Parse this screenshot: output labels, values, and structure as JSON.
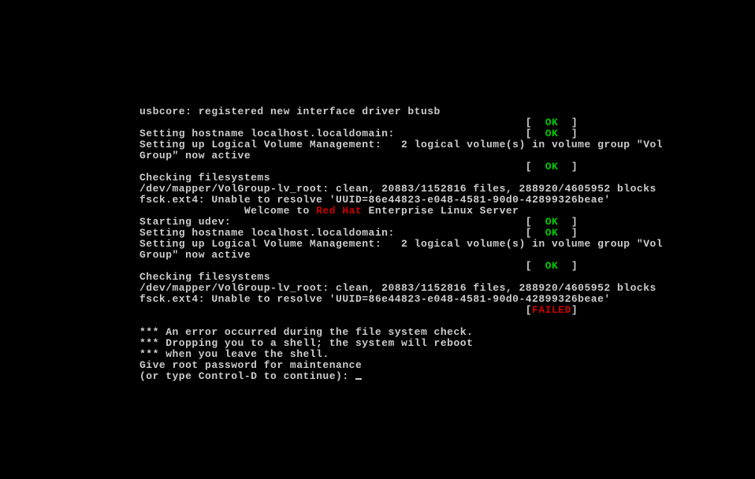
{
  "lines": [
    {
      "segments": [
        {
          "text": "usbcore: registered new interface driver btusb"
        }
      ]
    },
    {
      "segments": [
        {
          "text": "                                                           [  "
        },
        {
          "text": "OK",
          "cls": "green"
        },
        {
          "text": "  ]"
        }
      ]
    },
    {
      "segments": [
        {
          "text": "Setting hostname localhost.localdomain:                    [  "
        },
        {
          "text": "OK",
          "cls": "green"
        },
        {
          "text": "  ]"
        }
      ]
    },
    {
      "segments": [
        {
          "text": "Setting up Logical Volume Management:   2 logical volume(s) in volume group \"Vol"
        }
      ]
    },
    {
      "segments": [
        {
          "text": "Group\" now active"
        }
      ]
    },
    {
      "segments": [
        {
          "text": "                                                           [  "
        },
        {
          "text": "OK",
          "cls": "green"
        },
        {
          "text": "  ]"
        }
      ]
    },
    {
      "segments": [
        {
          "text": "Checking filesystems"
        }
      ]
    },
    {
      "segments": [
        {
          "text": "/dev/mapper/VolGroup-lv_root: clean, 20883/1152816 files, 288920/4605952 blocks"
        }
      ]
    },
    {
      "segments": [
        {
          "text": "fsck.ext4: Unable to resolve 'UUID=86e44823-e048-4581-90d0-42899326beae'"
        }
      ]
    },
    {
      "segments": [
        {
          "text": "                Welcome to "
        },
        {
          "text": "Red Hat",
          "cls": "red"
        },
        {
          "text": " Enterprise Linux Server"
        }
      ]
    },
    {
      "segments": [
        {
          "text": "Starting udev:                                             [  "
        },
        {
          "text": "OK",
          "cls": "green"
        },
        {
          "text": "  ]"
        }
      ]
    },
    {
      "segments": [
        {
          "text": "Setting hostname localhost.localdomain:                    [  "
        },
        {
          "text": "OK",
          "cls": "green"
        },
        {
          "text": "  ]"
        }
      ]
    },
    {
      "segments": [
        {
          "text": "Setting up Logical Volume Management:   2 logical volume(s) in volume group \"Vol"
        }
      ]
    },
    {
      "segments": [
        {
          "text": "Group\" now active"
        }
      ]
    },
    {
      "segments": [
        {
          "text": "                                                           [  "
        },
        {
          "text": "OK",
          "cls": "green"
        },
        {
          "text": "  ]"
        }
      ]
    },
    {
      "segments": [
        {
          "text": "Checking filesystems"
        }
      ]
    },
    {
      "segments": [
        {
          "text": "/dev/mapper/VolGroup-lv_root: clean, 20883/1152816 files, 288920/4605952 blocks"
        }
      ]
    },
    {
      "segments": [
        {
          "text": "fsck.ext4: Unable to resolve 'UUID=86e44823-e048-4581-90d0-42899326beae'"
        }
      ]
    },
    {
      "segments": [
        {
          "text": "                                                           ["
        },
        {
          "text": "FAILED",
          "cls": "red"
        },
        {
          "text": "]"
        }
      ]
    },
    {
      "segments": [
        {
          "text": ""
        }
      ]
    },
    {
      "segments": [
        {
          "text": "*** An error occurred during the file system check."
        }
      ]
    },
    {
      "segments": [
        {
          "text": "*** Dropping you to a shell; the system will reboot"
        }
      ]
    },
    {
      "segments": [
        {
          "text": "*** when you leave the shell."
        }
      ]
    },
    {
      "segments": [
        {
          "text": "Give root password for maintenance"
        }
      ]
    },
    {
      "segments": [
        {
          "text": "(or type Control-D to continue): "
        }
      ],
      "cursor": true
    }
  ]
}
